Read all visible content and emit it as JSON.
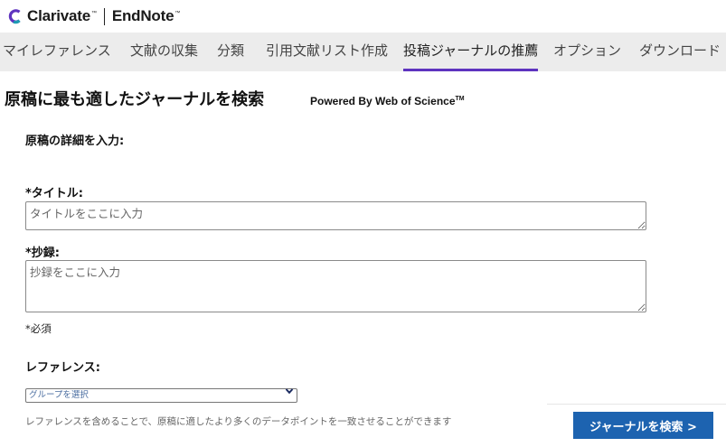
{
  "header": {
    "brand_clarivate": "Clarivate",
    "brand_endnote": "EndNote",
    "trademark": "™"
  },
  "nav": {
    "items": [
      {
        "label": "マイレファレンス"
      },
      {
        "label": "文献の収集"
      },
      {
        "label": "分類"
      },
      {
        "label": "引用文献リスト作成"
      },
      {
        "label": "投稿ジャーナルの推薦",
        "active": true
      },
      {
        "label": "オプション"
      },
      {
        "label": "ダウンロード"
      }
    ]
  },
  "main": {
    "title": "原稿に最も適したジャーナルを検索",
    "powered_by": "Powered By Web of Science",
    "powered_tm": "TM",
    "section_heading": "原稿の詳細を入力:",
    "title_field": {
      "label": "*タイトル:",
      "placeholder": "タイトルをここに入力",
      "value": ""
    },
    "abstract_field": {
      "label": "*抄録:",
      "placeholder": "抄録をここに入力",
      "value": ""
    },
    "required_note": "*必須",
    "reference_label": "レファレンス:",
    "reference_select": {
      "selected": "グループを選択"
    },
    "help_text": "レファレンスを含めることで、原稿に適したより多くのデータポイントを一致させることができます",
    "search_button": "ジャーナルを検索 >"
  },
  "colors": {
    "nav_background": "#ececec",
    "active_tab_underline": "#5e33bf",
    "primary_button": "#1d63b0",
    "logo_purple": "#5e33bf",
    "logo_teal": "#1e9bb3"
  }
}
